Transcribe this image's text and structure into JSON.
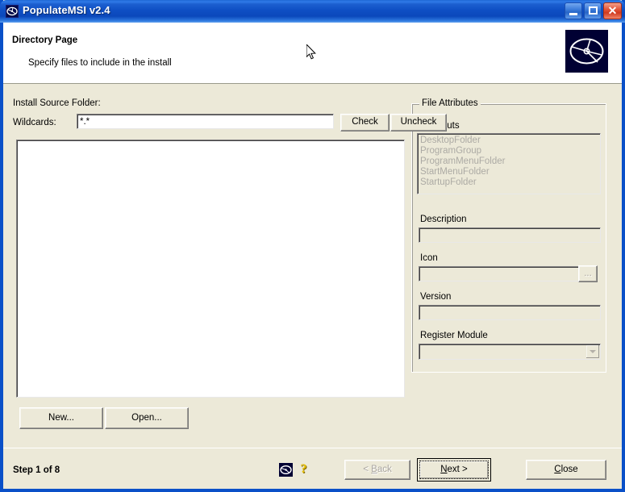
{
  "window": {
    "title": "PopulateMSI v2.4",
    "icon": "disc-icon",
    "minimize_label": "Minimize",
    "maximize_label": "Maximize",
    "close_label": "Close",
    "close_glyph": "✕",
    "accent_titlebar": "#0b48bb",
    "accent_close": "#cf3a20"
  },
  "header": {
    "title": "Directory Page",
    "subtitle": "Specify files to include in the install",
    "logo_name": "populatemsi-logo",
    "logo_bg": "#000033"
  },
  "main": {
    "install_source_label": "Install Source Folder:",
    "wildcards_label": "Wildcards:",
    "wildcards_value": "*.*",
    "wildcards_placeholder": "",
    "check_label": "Check",
    "uncheck_label": "Uncheck",
    "new_label": "New...",
    "open_label": "Open...",
    "file_list_items": []
  },
  "file_attributes": {
    "group_label": "File Attributes",
    "shortcuts_label": "Shortcuts",
    "shortcuts_items": [
      "DesktopFolder",
      "ProgramGroup",
      "ProgramMenuFolder",
      "StartMenuFolder",
      "StartupFolder"
    ],
    "description_label": "Description",
    "description_value": "",
    "icon_label": "Icon",
    "icon_value": "",
    "icon_browse_label": "...",
    "version_label": "Version",
    "version_value": "",
    "register_module_label": "Register Module",
    "register_module_value": "",
    "register_module_options": []
  },
  "footer": {
    "step_text": "Step 1 of 8",
    "status_icon": "disc-icon",
    "help_icon": "question-mark-icon",
    "help_glyph": "?",
    "back_label": "< Back",
    "back_label_pre": "< ",
    "back_label_accel": "B",
    "back_label_post": "ack",
    "next_label_pre": "",
    "next_label_accel": "N",
    "next_label_post": "ext >",
    "close_label_pre": "",
    "close_label_accel": "C",
    "close_label_post": "lose"
  }
}
